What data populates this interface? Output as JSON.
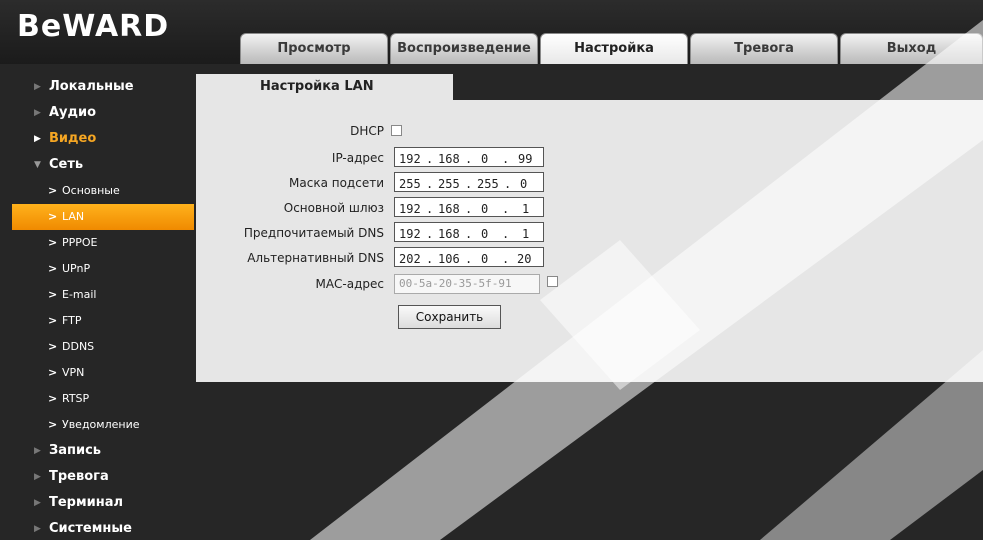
{
  "logo": "BeWARD",
  "tabs": [
    {
      "label": "Просмотр",
      "active": false
    },
    {
      "label": "Воспроизведение",
      "active": false
    },
    {
      "label": "Настройка",
      "active": true
    },
    {
      "label": "Тревога",
      "active": false
    },
    {
      "label": "Выход",
      "active": false
    }
  ],
  "sidebar": {
    "categories": {
      "local": "Локальные",
      "audio": "Аудио",
      "video": "Видео",
      "network": "Сеть",
      "record": "Запись",
      "alarm": "Тревога",
      "terminal": "Терминал",
      "system": "Системные"
    },
    "network_items": [
      "Основные",
      "LAN",
      "PPPOE",
      "UPnP",
      "E-mail",
      "FTP",
      "DDNS",
      "VPN",
      "RTSP",
      "Уведомление"
    ],
    "active_item": "LAN"
  },
  "panel": {
    "title": "Настройка LAN",
    "dhcp_label": "DHCP",
    "dhcp_checked": false,
    "fields": [
      {
        "label": "IP-адрес",
        "octets": [
          "192",
          "168",
          "0",
          "99"
        ]
      },
      {
        "label": "Маска подсети",
        "octets": [
          "255",
          "255",
          "255",
          "0"
        ]
      },
      {
        "label": "Основной шлюз",
        "octets": [
          "192",
          "168",
          "0",
          "1"
        ]
      },
      {
        "label": "Предпочитаемый DNS",
        "octets": [
          "192",
          "168",
          "0",
          "1"
        ]
      },
      {
        "label": "Альтернативный DNS",
        "octets": [
          "202",
          "106",
          "0",
          "20"
        ]
      }
    ],
    "mac_label": "МАС-адрес",
    "mac_value": "00-5a-20-35-5f-91",
    "mac_checked": false,
    "save_label": "Сохранить"
  }
}
